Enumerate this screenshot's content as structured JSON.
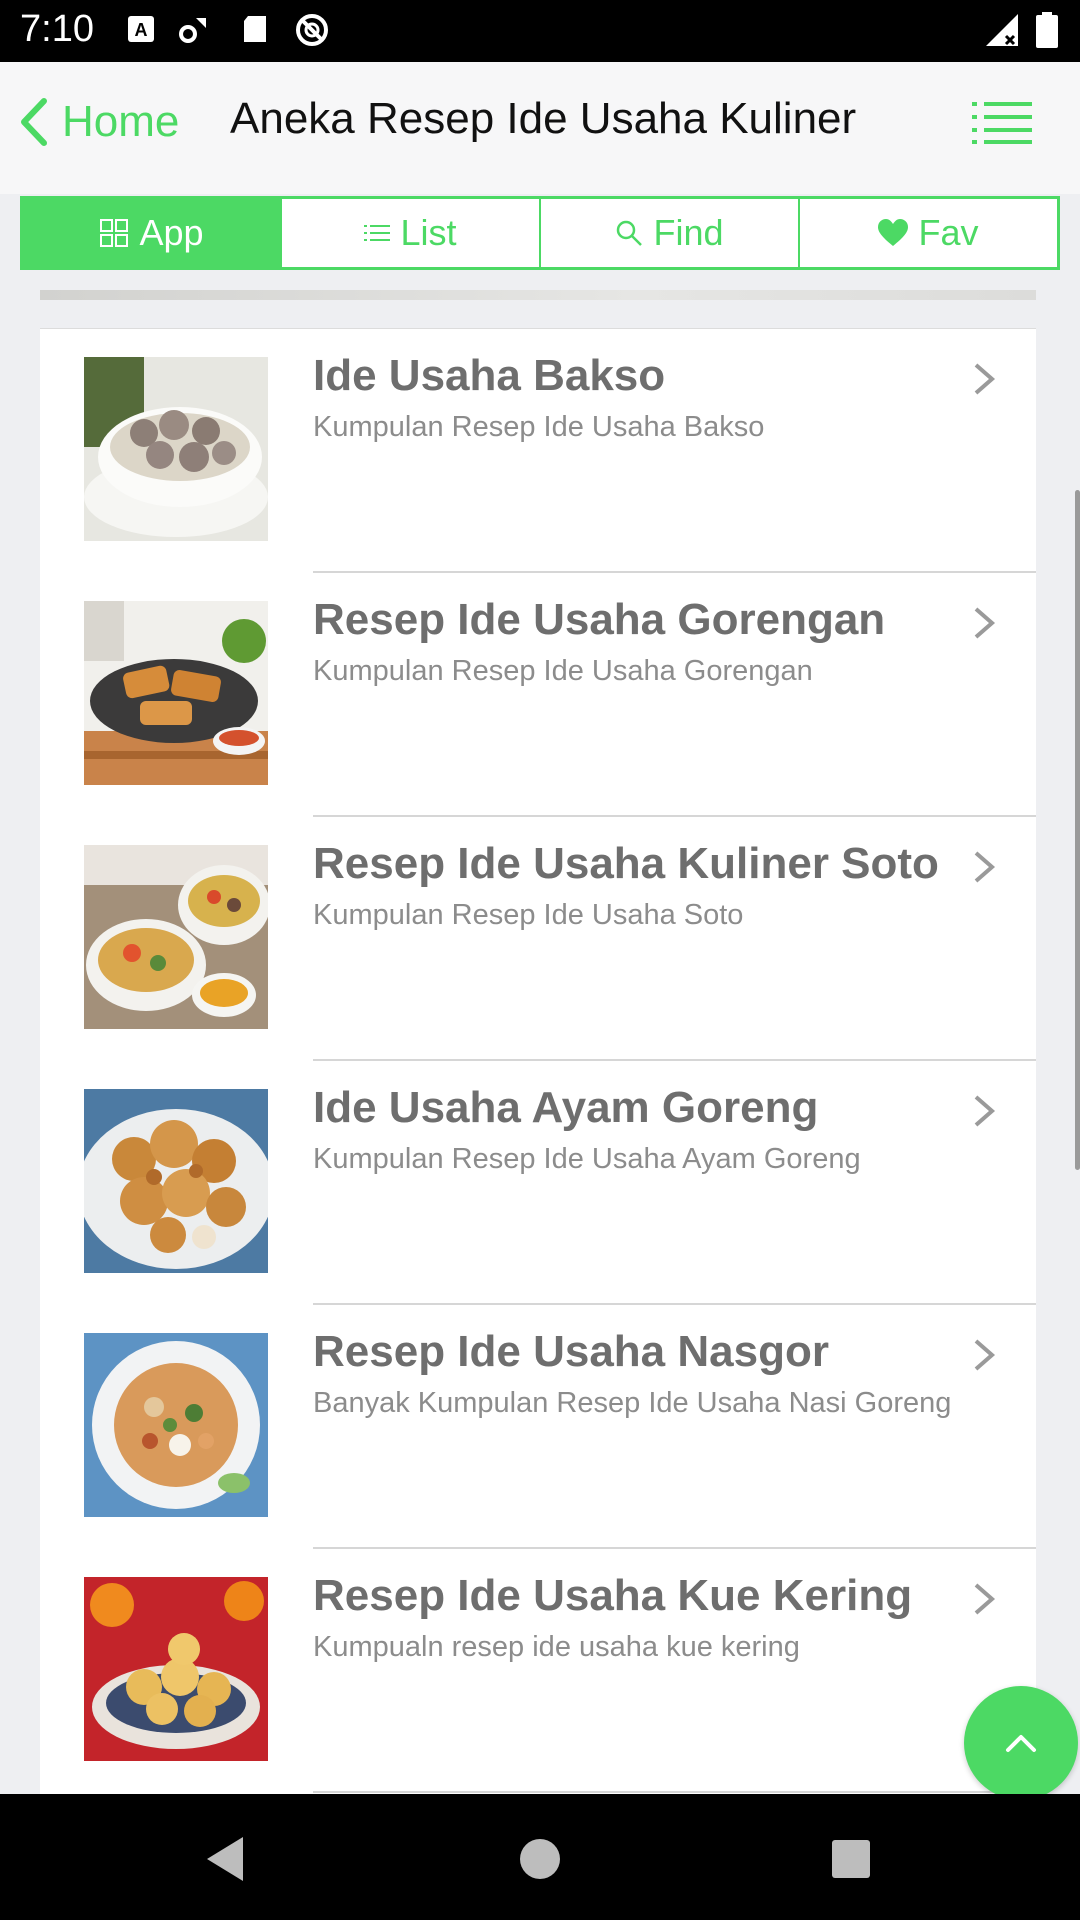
{
  "status": {
    "time": "7:10"
  },
  "header": {
    "back_label": "Home",
    "title": "Aneka Resep Ide Usaha Kuliner"
  },
  "tabs": [
    {
      "label": "App",
      "icon": "grid-icon",
      "active": true
    },
    {
      "label": "List",
      "icon": "list-icon",
      "active": false
    },
    {
      "label": "Find",
      "icon": "search-icon",
      "active": false
    },
    {
      "label": "Fav",
      "icon": "heart-icon",
      "active": false
    }
  ],
  "items": [
    {
      "title": "Ide Usaha Bakso",
      "subtitle": "Kumpulan Resep Ide Usaha Bakso"
    },
    {
      "title": "Resep Ide Usaha Gorengan",
      "subtitle": "Kumpulan Resep Ide Usaha Gorengan"
    },
    {
      "title": "Resep Ide Usaha Kuliner Soto",
      "subtitle": "Kumpulan Resep Ide Usaha Soto"
    },
    {
      "title": "Ide Usaha Ayam Goreng",
      "subtitle": "Kumpulan Resep Ide Usaha Ayam Goreng"
    },
    {
      "title": "Resep Ide Usaha Nasgor",
      "subtitle": "Banyak Kumpulan Resep Ide Usaha Nasi Goreng"
    },
    {
      "title": "Resep Ide Usaha Kue Kering",
      "subtitle": "Kumpualn resep ide usaha kue kering"
    }
  ],
  "colors": {
    "accent": "#4cd964",
    "title_text": "#6e6e6e",
    "subtitle_text": "#8c8c8c"
  }
}
